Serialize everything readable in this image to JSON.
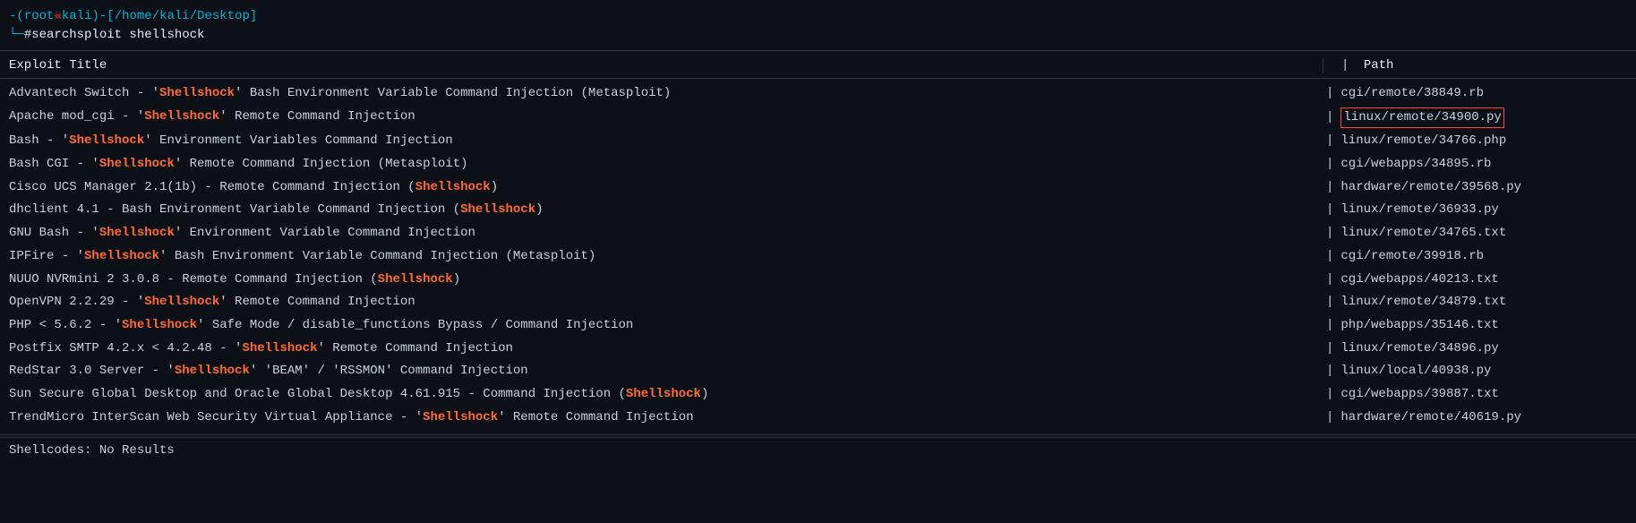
{
  "terminal": {
    "prompt": {
      "line1_open": "-(",
      "user": "root",
      "skull": "☠",
      "kali": "kali",
      "line1_close": ")-[",
      "path": "/home/kali/Desktop",
      "path_close": "]",
      "line2_prefix": "└─",
      "hash": "#",
      "command": " searchsploit shellshock"
    },
    "table": {
      "col1_header": "Exploit Title",
      "col2_header": "Path",
      "divider": "|"
    },
    "results": [
      {
        "title_prefix": "Advantech Switch - '",
        "keyword": "Shellshock",
        "title_suffix": "' Bash Environment Variable Command Injection (Metasploit)",
        "path": "cgi/remote/38849.rb",
        "highlighted": false
      },
      {
        "title_prefix": "Apache mod_cgi - '",
        "keyword": "Shellshock",
        "title_suffix": "' Remote Command Injection",
        "path": "linux/remote/34900.py",
        "highlighted": true
      },
      {
        "title_prefix": "Bash - '",
        "keyword": "Shellshock",
        "title_suffix": "' Environment Variables Command Injection",
        "path": "linux/remote/34766.php",
        "highlighted": false
      },
      {
        "title_prefix": "Bash CGI - '",
        "keyword": "Shellshock",
        "title_suffix": "' Remote Command Injection (Metasploit)",
        "path": "cgi/webapps/34895.rb",
        "highlighted": false
      },
      {
        "title_prefix": "Cisco UCS Manager 2.1(1b) - Remote Command Injection (",
        "keyword": "Shellshock",
        "title_suffix": ")",
        "path": "hardware/remote/39568.py",
        "highlighted": false
      },
      {
        "title_prefix": "dhclient 4.1 - Bash Environment Variable Command Injection (",
        "keyword": "Shellshock",
        "title_suffix": ")",
        "path": "linux/remote/36933.py",
        "highlighted": false
      },
      {
        "title_prefix": "GNU Bash - '",
        "keyword": "Shellshock",
        "title_suffix": "' Environment Variable Command Injection",
        "path": "linux/remote/34765.txt",
        "highlighted": false
      },
      {
        "title_prefix": "IPFire - '",
        "keyword": "Shellshock",
        "title_suffix": "' Bash Environment Variable Command Injection (Metasploit)",
        "path": "cgi/remote/39918.rb",
        "highlighted": false
      },
      {
        "title_prefix": "NUUO NVRmini 2 3.0.8 - Remote Command Injection (",
        "keyword": "Shellshock",
        "title_suffix": ")",
        "path": "cgi/webapps/40213.txt",
        "highlighted": false
      },
      {
        "title_prefix": "OpenVPN 2.2.29 - '",
        "keyword": "Shellshock",
        "title_suffix": "' Remote Command Injection",
        "path": "linux/remote/34879.txt",
        "highlighted": false
      },
      {
        "title_prefix": "PHP < 5.6.2 - '",
        "keyword": "Shellshock",
        "title_suffix": "' Safe Mode / disable_functions Bypass / Command Injection",
        "path": "php/webapps/35146.txt",
        "highlighted": false
      },
      {
        "title_prefix": "Postfix SMTP 4.2.x < 4.2.48 - '",
        "keyword": "Shellshock",
        "title_suffix": "' Remote Command Injection",
        "path": "linux/remote/34896.py",
        "highlighted": false
      },
      {
        "title_prefix": "RedStar 3.0 Server - '",
        "keyword": "Shellshock",
        "title_suffix": "' 'BEAM' / 'RSSMON' Command Injection",
        "path": "linux/local/40938.py",
        "highlighted": false
      },
      {
        "title_prefix": "Sun Secure Global Desktop and Oracle Global Desktop 4.61.915 - Command Injection (",
        "keyword": "Shellshock",
        "title_suffix": ")",
        "path": "cgi/webapps/39887.txt",
        "highlighted": false
      },
      {
        "title_prefix": "TrendMicro InterScan Web Security Virtual Appliance - '",
        "keyword": "Shellshock",
        "title_suffix": "' Remote Command Injection",
        "path": "hardware/remote/40619.py",
        "highlighted": false
      }
    ],
    "footer": {
      "shellcodes_label": "Shellcodes: No Results"
    }
  }
}
